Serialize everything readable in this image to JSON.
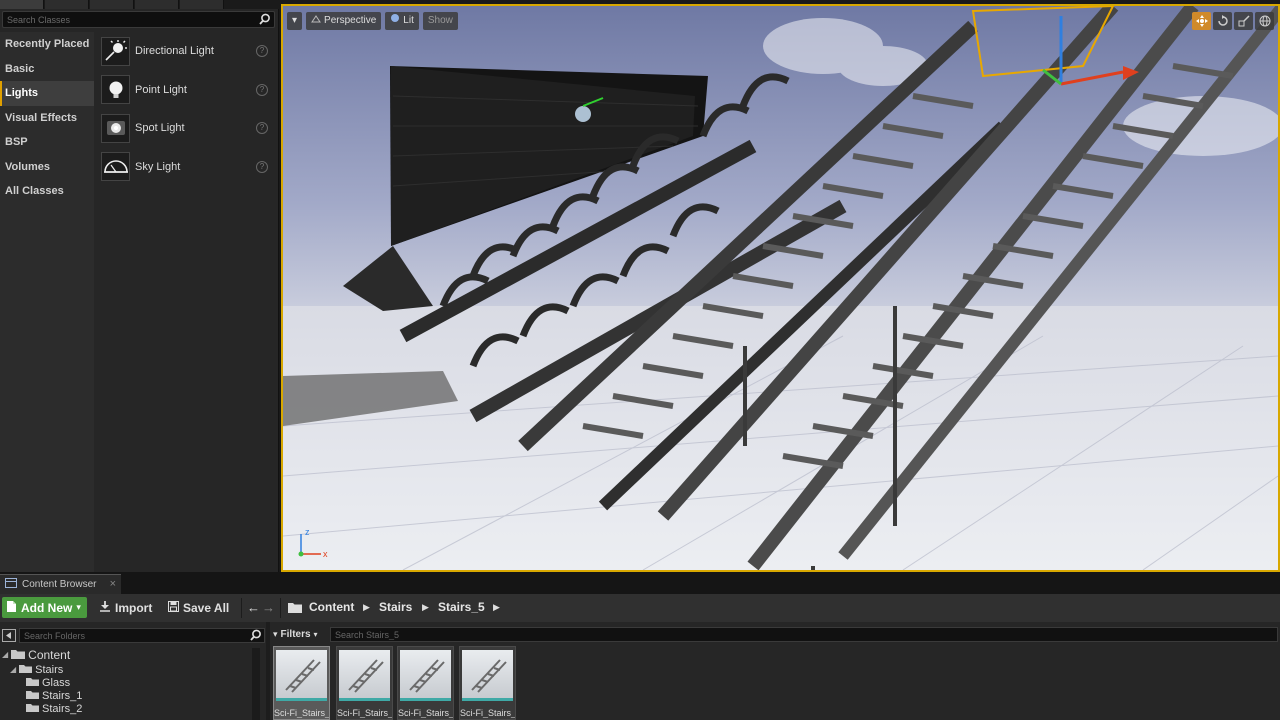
{
  "place_panel": {
    "search_placeholder": "Search Classes",
    "categories": [
      {
        "label": "Recently Placed",
        "active": false
      },
      {
        "label": "Basic",
        "active": false
      },
      {
        "label": "Lights",
        "active": true
      },
      {
        "label": "Visual Effects",
        "active": false
      },
      {
        "label": "BSP",
        "active": false
      },
      {
        "label": "Volumes",
        "active": false
      },
      {
        "label": "All Classes",
        "active": false
      }
    ],
    "items": [
      {
        "label": "Directional Light",
        "icon": "directional-light-icon"
      },
      {
        "label": "Point Light",
        "icon": "point-light-icon"
      },
      {
        "label": "Spot Light",
        "icon": "spot-light-icon"
      },
      {
        "label": "Sky Light",
        "icon": "sky-light-icon"
      }
    ],
    "help_glyph": "?"
  },
  "viewport": {
    "view_mode": "Perspective",
    "lighting_mode": "Lit",
    "show_label": "Show",
    "axis_labels": {
      "z": "z",
      "x": "x"
    },
    "highlight_color": "#d8a800"
  },
  "content_browser": {
    "tab_label": "Content Browser",
    "close_glyph": "×",
    "toolbar": {
      "add_new": "Add New",
      "import": "Import",
      "save_all": "Save All"
    },
    "breadcrumb": [
      "Content",
      "Stairs",
      "Stairs_5"
    ],
    "folder_search_placeholder": "Search Folders",
    "folders": {
      "root": "Content",
      "stairs": "Stairs",
      "glass": "Glass",
      "stairs_1": "Stairs_1",
      "stairs_2": "Stairs_2"
    },
    "filters_label": "Filters",
    "asset_search_placeholder": "Search Stairs_5",
    "assets": [
      {
        "label": "Sci-Fi_Stairs_",
        "selected": true
      },
      {
        "label": "Sci-Fi_Stairs_",
        "selected": false
      },
      {
        "label": "Sci-Fi_Stairs_",
        "selected": false
      },
      {
        "label": "Sci-Fi_Stairs_",
        "selected": false
      }
    ],
    "add_new_color": "#4a9a3e",
    "asset_type_color": "#3fa9a6"
  }
}
